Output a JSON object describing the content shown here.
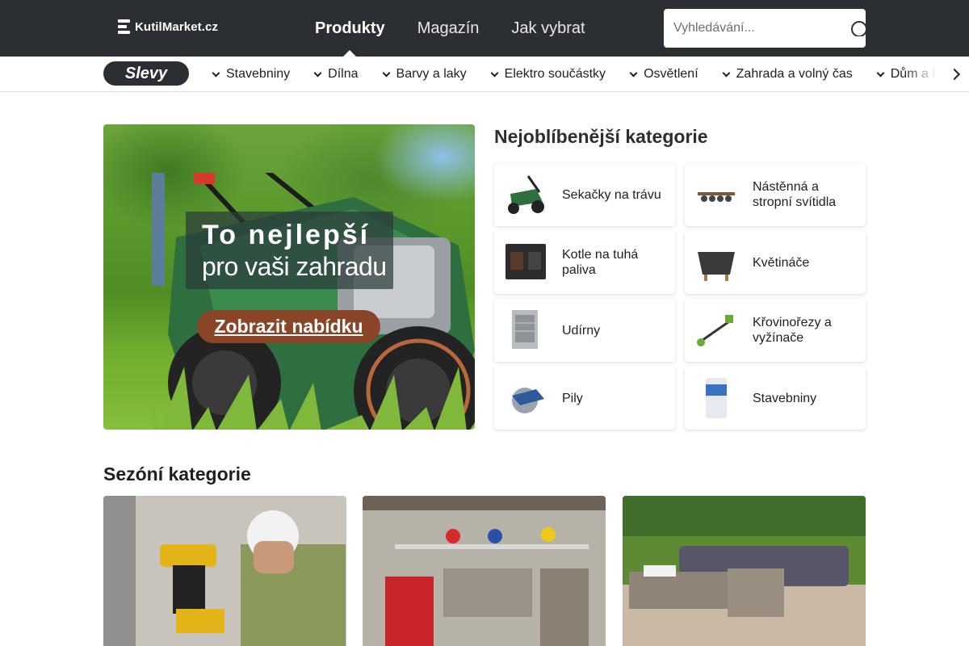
{
  "header": {
    "logo_text": "KutilMarket.cz",
    "nav": [
      {
        "label": "Produkty",
        "active": true
      },
      {
        "label": "Magazín",
        "active": false
      },
      {
        "label": "Jak vybrat",
        "active": false
      }
    ],
    "search": {
      "placeholder": "Vyhledávání...",
      "value": ""
    }
  },
  "catbar": {
    "sale_label": "Slevy",
    "items": [
      "Stavebniny",
      "Dílna",
      "Barvy a laky",
      "Elektro součástky",
      "Osvětlení",
      "Zahrada a volný čas",
      "Dům a byt"
    ]
  },
  "hero": {
    "title": "To nejlepší",
    "subtitle": "pro vaši zahradu",
    "button_label": "Zobrazit nabídku"
  },
  "popular": {
    "title": "Nejoblíbenější kategorie",
    "items": [
      {
        "label": "Sekačky na trávu",
        "icon": "lawnmower-icon"
      },
      {
        "label": "Nástěnná a stropní svítidla",
        "icon": "ceiling-light-icon"
      },
      {
        "label": "Kotle na tuhá paliva",
        "icon": "stove-icon"
      },
      {
        "label": "Květináče",
        "icon": "flowerpot-icon"
      },
      {
        "label": "Udírny",
        "icon": "smoker-icon"
      },
      {
        "label": "Křovinořezy a vyžínače",
        "icon": "trimmer-icon"
      },
      {
        "label": "Pily",
        "icon": "circular-saw-icon"
      },
      {
        "label": "Stavebniny",
        "icon": "cement-bag-icon"
      }
    ]
  },
  "seasonal": {
    "title": "Sezóní kategorie"
  },
  "colors": {
    "header_bg": "#2b2e33",
    "button_brown": "#8a4529",
    "text": "#1f1f1f"
  }
}
